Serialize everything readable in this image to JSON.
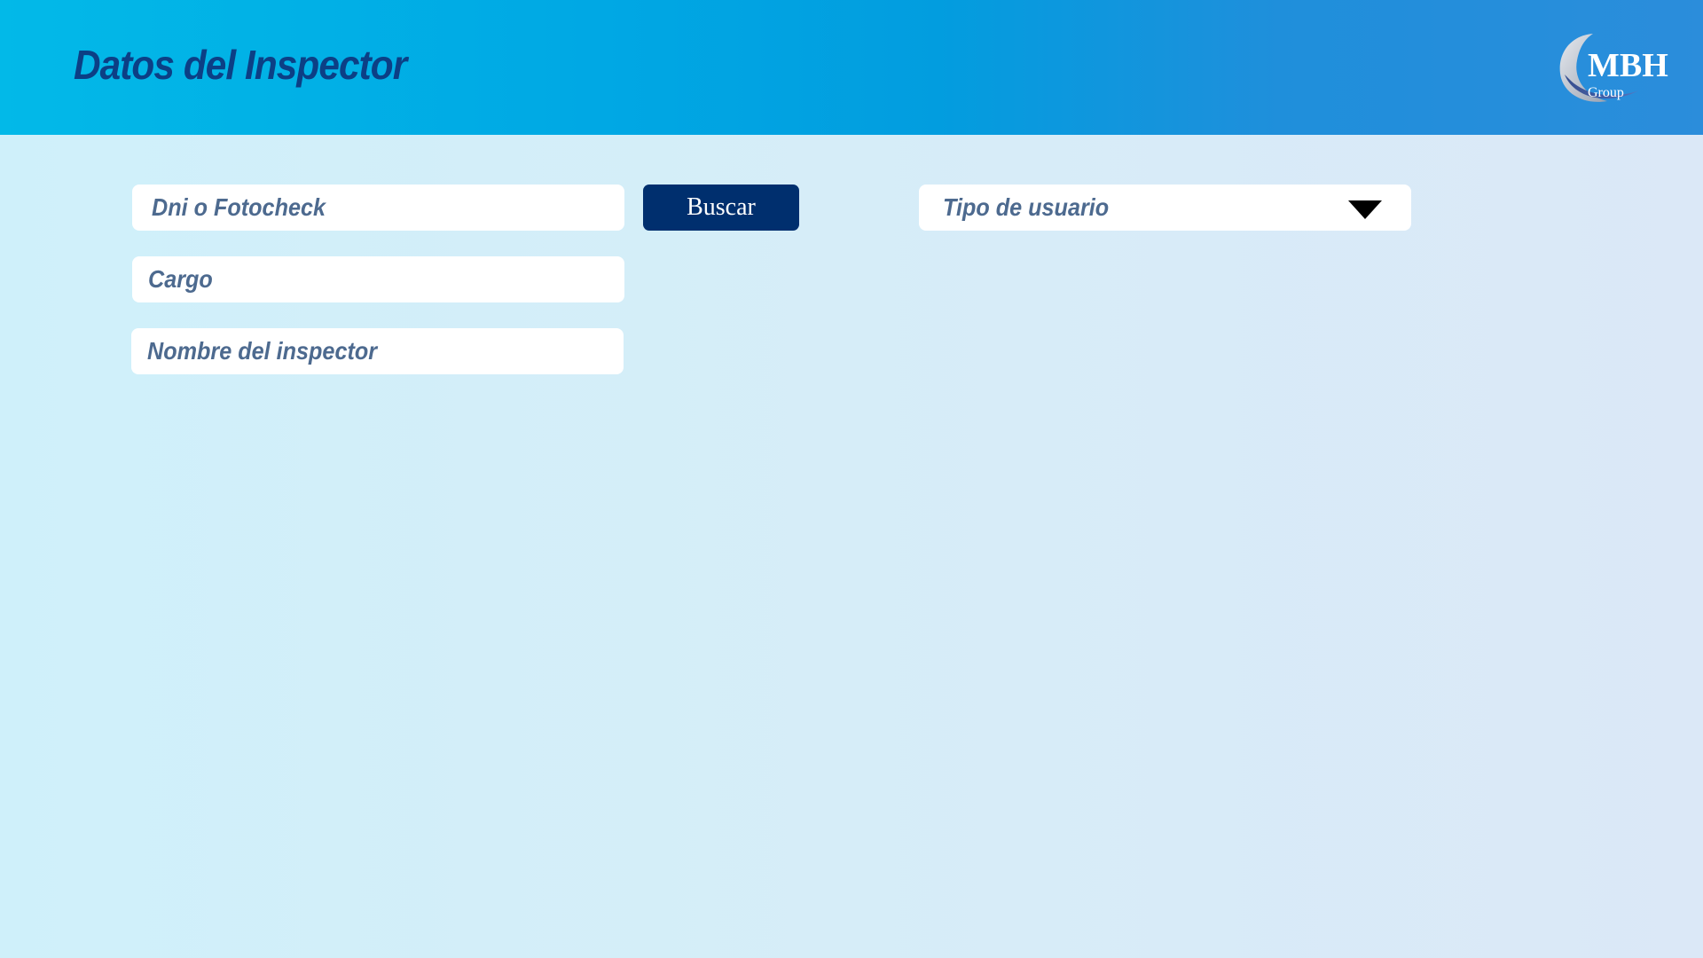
{
  "header": {
    "title": "Datos del Inspector",
    "logo": {
      "text": "MBH",
      "subtext": "Group"
    }
  },
  "form": {
    "dni_placeholder": "Dni o Fotocheck",
    "search_button": "Buscar",
    "user_type_placeholder": "Tipo de usuario",
    "cargo_placeholder": "Cargo",
    "inspector_name_placeholder": "Nombre del inspector"
  },
  "colors": {
    "header_gradient_start": "#02b9e8",
    "header_gradient_end": "#2b8ddb",
    "title": "#0c3f85",
    "button": "#002f6e",
    "placeholder": "#4d6a8f",
    "background": "#d6edf8"
  },
  "icons": {
    "dropdown": "caret-down-icon",
    "logo": "crescent-logo"
  }
}
